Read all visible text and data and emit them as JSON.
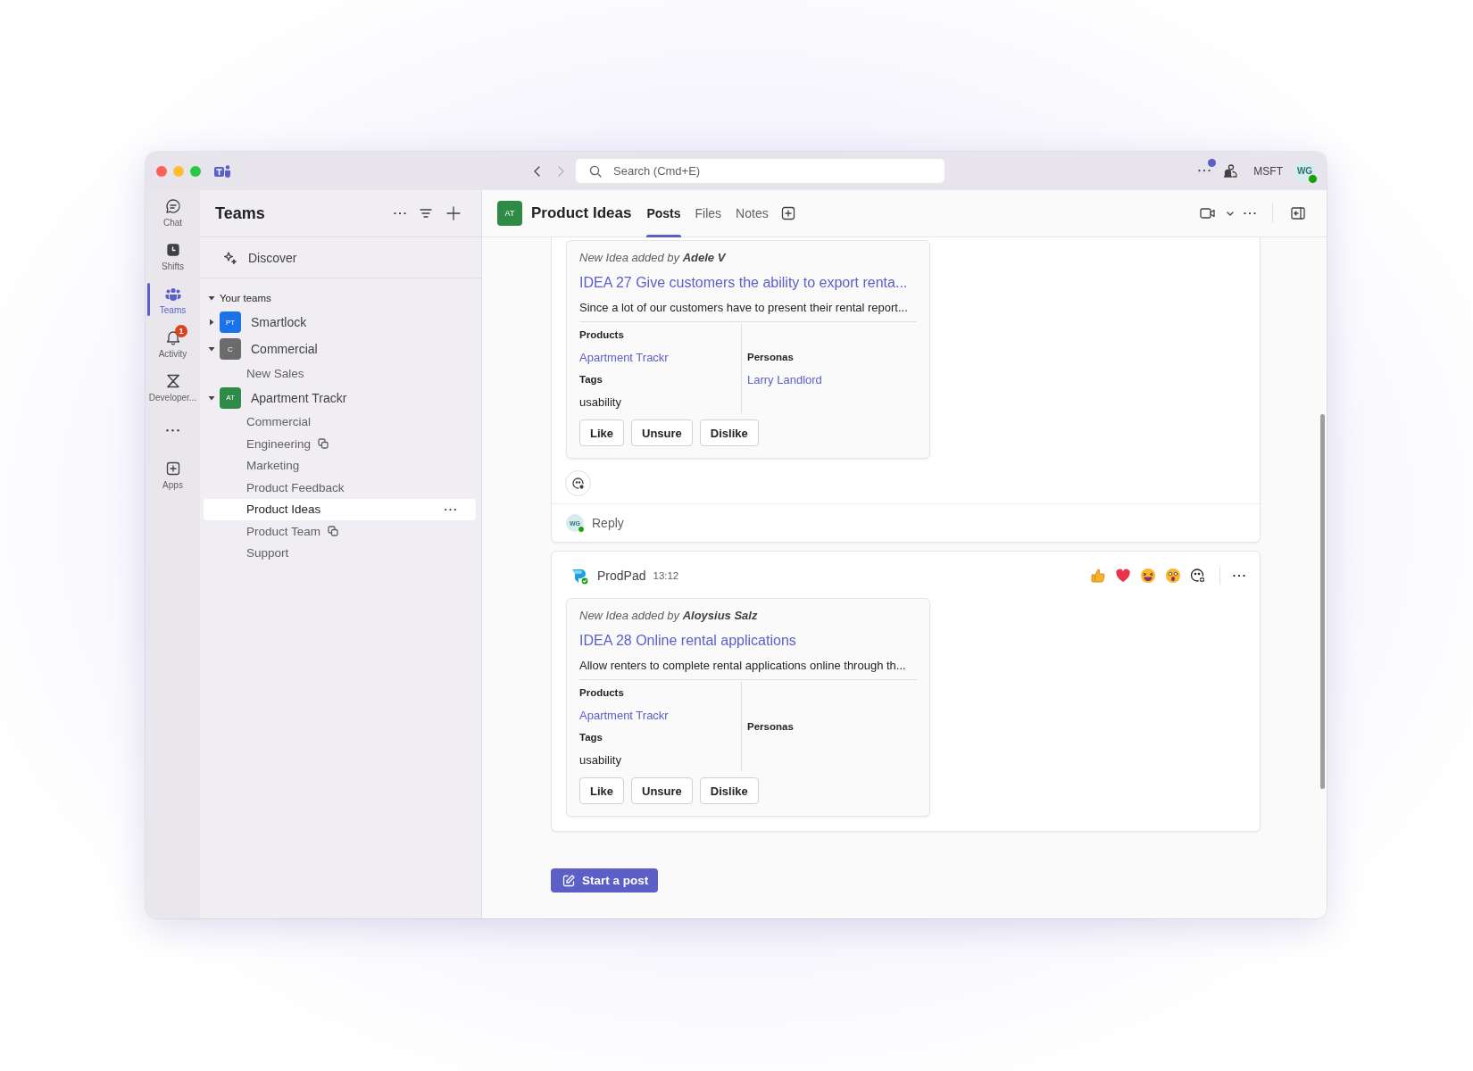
{
  "title_bar": {
    "back_enabled": true,
    "forward_enabled": false,
    "search": {
      "placeholder": "Search (Cmd+E)"
    },
    "has_notification": true,
    "org": "MSFT",
    "user": {
      "initials": "WG",
      "online": true
    }
  },
  "rail": {
    "items": [
      {
        "kind": "chat",
        "label": "Chat",
        "selected": false
      },
      {
        "kind": "shifts",
        "label": "Shifts",
        "selected": false
      },
      {
        "kind": "teams",
        "label": "Teams",
        "selected": true
      },
      {
        "kind": "activity",
        "label": "Activity",
        "selected": false,
        "badge": "1"
      },
      {
        "kind": "developer",
        "label": "Developer...",
        "selected": false
      },
      {
        "kind": "more",
        "selected": false
      },
      {
        "kind": "apps",
        "label": "Apps",
        "selected": false
      }
    ]
  },
  "sidebar": {
    "title": "Teams",
    "discover": "Discover",
    "section": {
      "label": "Your teams",
      "expanded": true
    },
    "teams": [
      {
        "name": "Smartlock",
        "initials": "PT",
        "color": "#1a73e8",
        "expanded": false
      },
      {
        "name": "Commercial",
        "initials": "C",
        "color": "#6b6b6b",
        "expanded": true,
        "channels": [
          {
            "name": "New Sales",
            "selected": false,
            "shared": false
          }
        ]
      },
      {
        "name": "Apartment Trackr",
        "initials": "AT",
        "color": "#2e8b45",
        "expanded": true,
        "channels": [
          {
            "name": "Commercial",
            "selected": false,
            "shared": false
          },
          {
            "name": "Engineering",
            "selected": false,
            "shared": true
          },
          {
            "name": "Marketing",
            "selected": false,
            "shared": false
          },
          {
            "name": "Product Feedback",
            "selected": false,
            "shared": false
          },
          {
            "name": "Product Ideas",
            "selected": true,
            "shared": false
          },
          {
            "name": "Product Team",
            "selected": false,
            "shared": true
          },
          {
            "name": "Support",
            "selected": false,
            "shared": false
          }
        ]
      }
    ]
  },
  "channel": {
    "initials": "AT",
    "name": "Product Ideas",
    "tabs": [
      {
        "label": "Posts",
        "selected": true
      },
      {
        "label": "Files",
        "selected": false
      },
      {
        "label": "Notes",
        "selected": false
      }
    ]
  },
  "posts": [
    {
      "card": {
        "added_by": "New Idea added by **Adele V**",
        "title": "IDEA 27 Give customers the ability to export renta...",
        "description": "Since a lot of our customers have to present their rental report...",
        "products_label": "Products",
        "product": "Apartment Trackr",
        "tags_label": "Tags",
        "tag": "usability",
        "personas_label": "Personas",
        "persona": "Larry Landlord",
        "actions": [
          "Like",
          "Unsure",
          "Dislike"
        ]
      },
      "reply": {
        "initials": "WG",
        "label": "Reply"
      }
    },
    {
      "author": "ProdPad",
      "time": "13:12",
      "card": {
        "added_by": "New Idea added by **Aloysius Salz**",
        "title": "IDEA 28 Online rental applications",
        "description": "Allow renters to complete rental applications online through th...",
        "products_label": "Products",
        "product": "Apartment Trackr",
        "tags_label": "Tags",
        "tag": "usability",
        "personas_label": "Personas",
        "actions": [
          "Like",
          "Unsure",
          "Dislike"
        ]
      }
    }
  ],
  "start_post": "Start a post"
}
